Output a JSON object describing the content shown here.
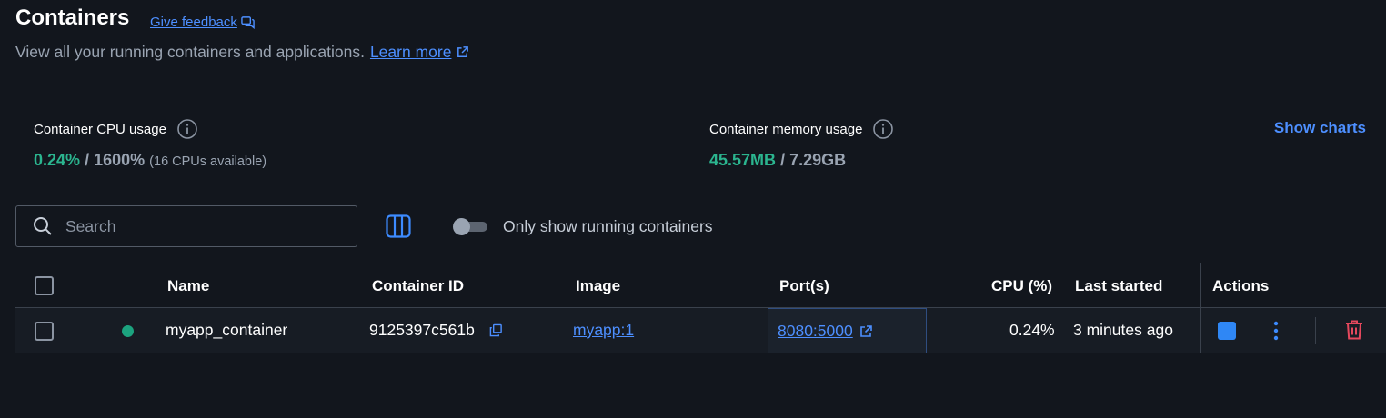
{
  "header": {
    "title": "Containers",
    "feedback_label": "Give feedback",
    "subtitle": "View all your running containers and applications.",
    "learn_more": "Learn more"
  },
  "stats": {
    "cpu": {
      "label": "Container CPU usage",
      "used": "0.24%",
      "separator": "/",
      "total": "1600%",
      "note": "(16 CPUs available)"
    },
    "memory": {
      "label": "Container memory usage",
      "used": "45.57MB",
      "separator": "/",
      "total": "7.29GB"
    },
    "show_charts": "Show charts"
  },
  "toolbar": {
    "search_placeholder": "Search",
    "toggle_label": "Only show running containers",
    "toggle_on": false
  },
  "table": {
    "columns": [
      "Name",
      "Container ID",
      "Image",
      "Port(s)",
      "CPU (%)",
      "Last started",
      "Actions"
    ],
    "rows": [
      {
        "status": "running",
        "name": "myapp_container",
        "container_id": "9125397c561b",
        "image": "myapp:1",
        "ports": "8080:5000",
        "cpu": "0.24%",
        "last_started": "3 minutes ago"
      }
    ]
  },
  "colors": {
    "background": "#12161d",
    "accent": "#4d8fff",
    "running": "#1ca37f",
    "delete": "#e5485d"
  }
}
